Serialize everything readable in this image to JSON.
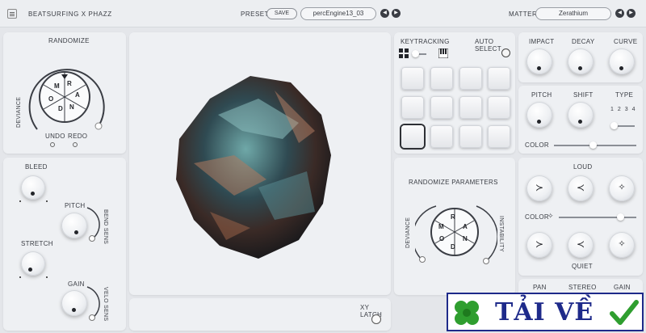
{
  "header": {
    "brand": "BEATSURFING X PHAZZ",
    "preset_label": "PRESET",
    "save_label": "SAVE",
    "preset_name": "percEngine13_03",
    "matter_label": "MATTER",
    "matter_name": "Zerathium",
    "prev_glyph": "◀",
    "next_glyph": "▶"
  },
  "randomize_panel": {
    "title": "RANDOMIZE",
    "deviance_label": "DEVIANCE",
    "undo_label": "UNDO",
    "redo_label": "REDO",
    "dice_letters": [
      "R",
      "A",
      "N",
      "D",
      "O",
      "M"
    ]
  },
  "left_bottom_panel": {
    "bleed_label": "BLEED",
    "pitch_label": "PITCH",
    "bend_sens_label": "BEND SENS",
    "stretch_label": "STRETCH",
    "gain_label": "GAIN",
    "velo_sens_label": "VELO SENS"
  },
  "keytracking_panel": {
    "keytracking_label": "KEYTRACKING",
    "auto_select_label": "AUTO SELECT",
    "grid_icon": "grid-icon",
    "piano_icon": "piano-icon",
    "selected_pad": 8
  },
  "randomize_params_panel": {
    "title": "RANDOMIZE PARAMETERS",
    "deviance_label": "DEVIANCE",
    "instability_label": "INSTABILITY",
    "dice_letters": [
      "R",
      "A",
      "N",
      "D",
      "O",
      "M"
    ]
  },
  "envelope_panel": {
    "impact_label": "IMPACT",
    "decay_label": "DECAY",
    "curve_label": "CURVE"
  },
  "pitch_panel": {
    "pitch_label": "PITCH",
    "shift_label": "SHIFT",
    "type_label": "TYPE",
    "type_options": [
      "1",
      "2",
      "3",
      "4"
    ],
    "color_label": "COLOR"
  },
  "loud_quiet_panel": {
    "loud_label": "LOUD",
    "color_label": "COLOR",
    "quiet_label": "QUIET"
  },
  "bottom_panel": {
    "xy_latch_label": "XY LATCH",
    "pan_label": "PAN",
    "stereo_label": "STEREO",
    "gain_label": "GAIN"
  },
  "watermark": {
    "text": "TẢI VỀ"
  },
  "colors": {
    "background": "#e4e6ea",
    "panel": "#eef0f3",
    "accent_dark": "#23252a",
    "watermark_blue": "#1e2a8a",
    "watermark_green": "#2f9e2f"
  }
}
